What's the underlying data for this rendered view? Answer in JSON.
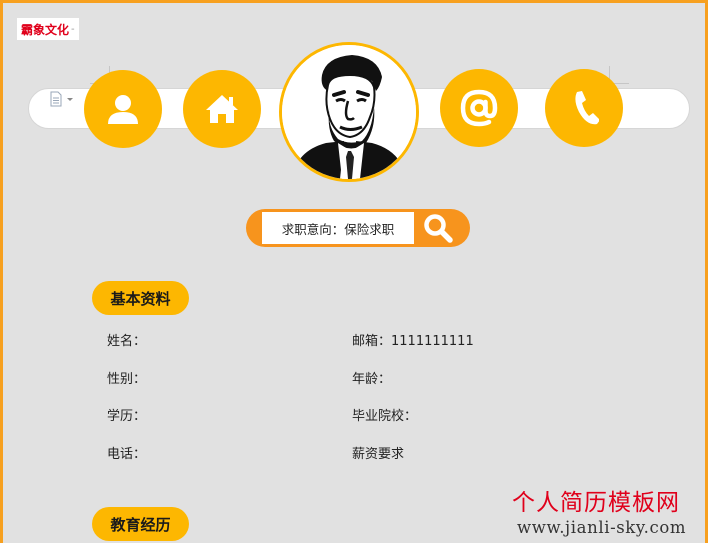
{
  "brand": {
    "text": "霸象文化",
    "dash": "-"
  },
  "nav": {
    "icons": [
      "person-icon",
      "home-icon",
      "at-sign-icon",
      "phone-icon"
    ]
  },
  "job_intent": {
    "label": "求职意向：保险求职",
    "search_icon": "search-icon"
  },
  "sections": {
    "basic": {
      "title": "基本资料",
      "fields": {
        "name": "姓名：",
        "email": "邮箱：1111111111",
        "gender": "性别：",
        "age": "年龄：",
        "education": "学历：",
        "school": "毕业院校：",
        "phone": "电话：",
        "salary": "薪资要求"
      }
    },
    "education": {
      "title": "教育经历"
    }
  },
  "watermark": {
    "title": "个人简历模板网",
    "url": "www.jianli-sky.com"
  },
  "colors": {
    "accent": "#fdb701",
    "accent_dark": "#f7941d",
    "border": "#f7a01f",
    "background": "#e1e1e1",
    "watermark_red": "#e0001b"
  }
}
